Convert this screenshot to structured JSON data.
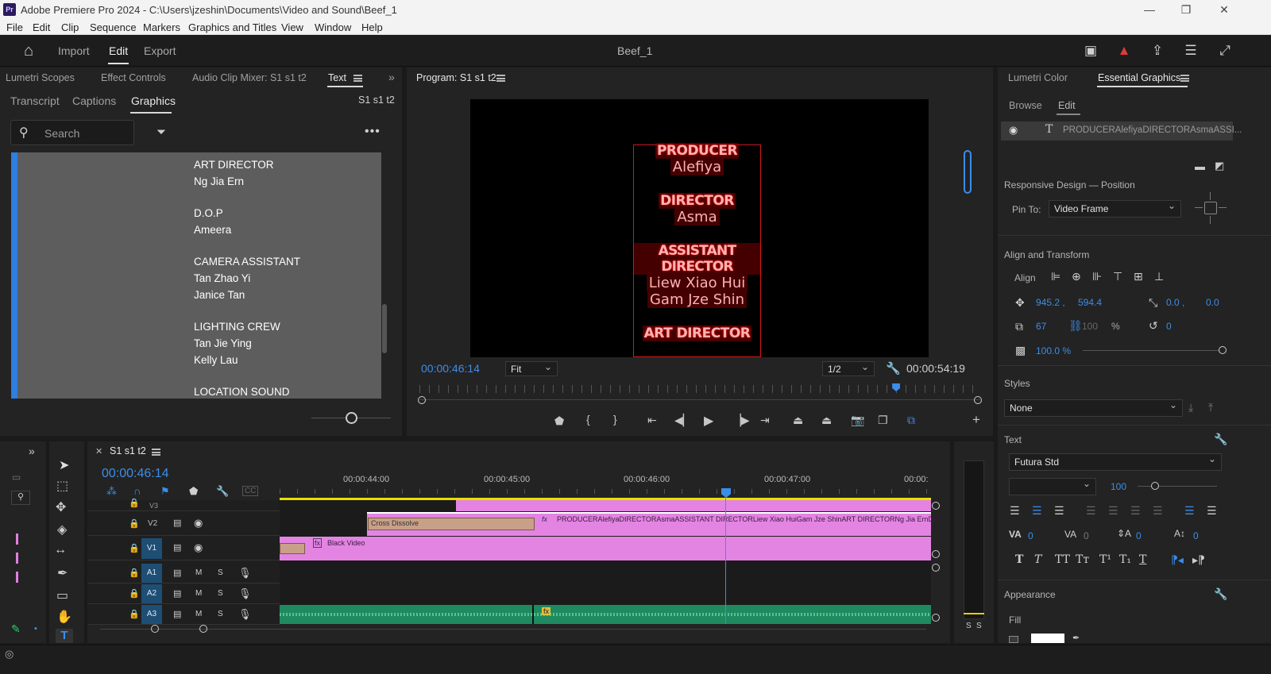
{
  "window": {
    "app_badge": "Pr",
    "title": "Adobe Premiere Pro 2024 - C:\\Users\\jzeshin\\Documents\\Video and Sound\\Beef_1",
    "minimize": "—",
    "maximize": "❐",
    "close": "✕"
  },
  "menubar": [
    "File",
    "Edit",
    "Clip",
    "Sequence",
    "Markers",
    "Graphics and Titles",
    "View",
    "Window",
    "Help"
  ],
  "workspace": {
    "tabs": [
      "Import",
      "Edit",
      "Export"
    ],
    "active_tab": "Edit",
    "project_name": "Beef_1"
  },
  "left_panel": {
    "tabs": [
      "Lumetri Scopes",
      "Effect Controls",
      "Audio Clip Mixer: S1 s1 t2",
      "Text"
    ],
    "active_tab": "Text",
    "sub_tabs": [
      "Transcript",
      "Captions",
      "Graphics"
    ],
    "active_sub_tab": "Graphics",
    "sequence_label": "S1 s1 t2",
    "search_placeholder": "Search",
    "credits_lines": [
      "ART DIRECTOR",
      "Ng Jia Ern",
      "D.O.P",
      "Ameera",
      "CAMERA ASSISTANT",
      "Tan Zhao Yi",
      "Janice Tan",
      "LIGHTING CREW",
      "Tan Jie Ying",
      "Kelly Lau",
      "LOCATION SOUND"
    ]
  },
  "program_monitor": {
    "title": "Program: S1 s1 t2",
    "credits": [
      {
        "role": "PRODUCER",
        "names": [
          "Alefiya"
        ]
      },
      {
        "role": "DIRECTOR",
        "names": [
          "Asma"
        ]
      },
      {
        "role": "ASSISTANT DIRECTOR",
        "names": [
          "Liew Xiao Hui",
          "Gam Jze Shin"
        ]
      },
      {
        "role": "ART DIRECTOR",
        "names": []
      }
    ],
    "current_time": "00:00:46:14",
    "fit": "Fit",
    "resolution": "1/2",
    "duration": "00:00:54:19",
    "playhead_fraction": 0.85
  },
  "timeline": {
    "sequence_tab": "S1 s1 t2",
    "current_time": "00:00:46:14",
    "ruler_labels": [
      "00:00:44:00",
      "00:00:45:00",
      "00:00:46:00",
      "00:00:47:00",
      "00:00:"
    ],
    "tracks": [
      {
        "label": "V3",
        "type": "video"
      },
      {
        "label": "V2",
        "type": "video"
      },
      {
        "label": "V1",
        "type": "video"
      },
      {
        "label": "A1",
        "type": "audio"
      },
      {
        "label": "A2",
        "type": "audio"
      },
      {
        "label": "A3",
        "type": "audio"
      }
    ],
    "clips": {
      "cross_dissolve": "Cross Dissolve",
      "credits_clip": "PRODUCERAlefiyaDIRECTORAsmaASSISTANT DIRECTORLiew Xiao HuiGam Jze ShinART DIRECTORNg Jia ErnD.O.",
      "black_video": "Black Video",
      "fx_badge": "fx"
    },
    "m_label": "M",
    "s_label": "S",
    "meter_labels": [
      "S",
      "S"
    ]
  },
  "right_panel": {
    "tabs": [
      "Lumetri Color",
      "Essential Graphics"
    ],
    "active_tab": "Essential Graphics",
    "sub_tabs": [
      "Browse",
      "Edit"
    ],
    "active_sub_tab": "Edit",
    "layer_name": "PRODUCERAlefiyaDIRECTORAsmaASSI...",
    "responsive_design": "Responsive Design — Position",
    "pin_to_label": "Pin To:",
    "pin_to_value": "Video Frame",
    "align_transform": "Align and Transform",
    "align_label": "Align",
    "position_x": "945.2 ,",
    "position_y": "594.4",
    "anchor_x": "0.0 ,",
    "anchor_y": "0.0",
    "scale": "67",
    "scale_locked": "100",
    "percent": "%",
    "rotation": "0",
    "opacity": "100.0 %",
    "styles_label": "Styles",
    "styles_value": "None",
    "text_label": "Text",
    "font_value": "Futura Std",
    "font_size": "100",
    "tracking_value": "0",
    "kerning_value": "0",
    "leading_value": "0",
    "baseline_value": "0",
    "appearance_label": "Appearance",
    "fill_label": "Fill"
  }
}
